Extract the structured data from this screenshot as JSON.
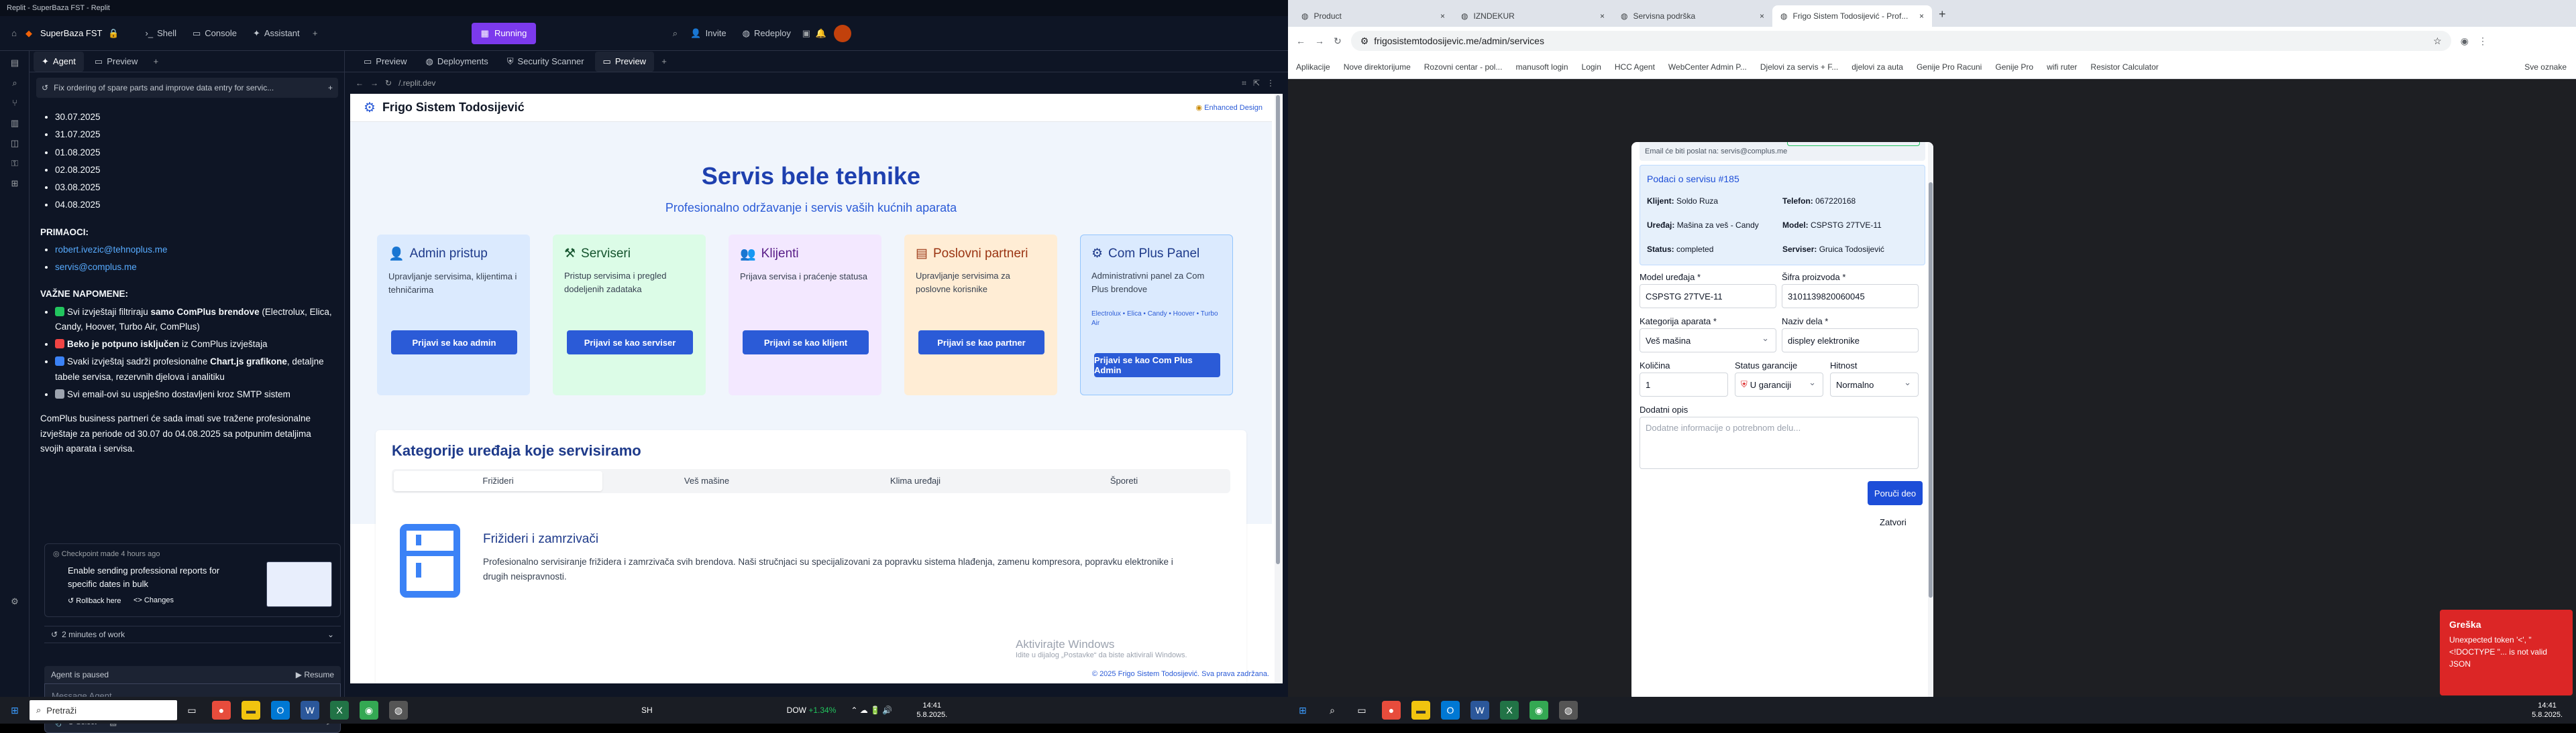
{
  "left_window": {
    "title": "Replit - SuperBaza FST - Replit",
    "project_name": "SuperBaza FST",
    "top_tabs": [
      "Shell",
      "Console",
      "Assistant"
    ],
    "run_status": "Running",
    "invite_label": "Invite",
    "redeploy_label": "Redeploy",
    "agent_tabs": [
      "Agent",
      "Preview"
    ],
    "task_title": "Fix ordering of spare parts and improve data entry for servic...",
    "chat": {
      "dates": [
        "30.07.2025",
        "31.07.2025",
        "01.08.2025",
        "02.08.2025",
        "03.08.2025",
        "04.08.2025"
      ],
      "recipients_title": "PRIMAOCI:",
      "recipients": [
        "robert.ivezic@tehnoplus.me",
        "servis@complus.me"
      ],
      "notes_title": "VAŽNE NAPOMENE:",
      "notes": [
        {
          "icon_color": "#22c55e",
          "pre": "Svi izvještaji filtriraju ",
          "bold": "samo ComPlus brendove",
          "post": " (Electrolux, Elica, Candy, Hoover, Turbo Air, ComPlus)"
        },
        {
          "icon_color": "#ef4444",
          "pre": "",
          "bold": "Beko je potpuno isključen",
          "post": " iz ComPlus izvještaja"
        },
        {
          "icon_color": "#3b82f6",
          "pre": "Svaki izvještaj sadrži profesionalne ",
          "bold": "Chart.js grafikone",
          "post": ", detaljne tabele servisa, rezervnih djelova i analitiku"
        },
        {
          "icon_color": "#9ca3af",
          "pre": "Svi email-ovi su uspješno dostavljeni kroz SMTP sistem",
          "bold": "",
          "post": ""
        }
      ],
      "summary": "ComPlus business partneri će sada imati sve tražene profesionalne izvještaje za periode od 30.07 do 04.08.2025 sa potpunim detaljima svojih aparata i servisa.",
      "checkpoint_label": "Checkpoint made 4 hours ago",
      "checkpoint_title": "Enable sending professional reports for specific dates in bulk",
      "rollback_label": "Rollback here",
      "changes_label": "Changes",
      "work_label": "2 minutes of work",
      "paused_label": "Agent is paused",
      "resume_label": "Resume",
      "message_placeholder": "Message Agent...",
      "select_label": "Select"
    },
    "preview_tabs": [
      "Preview",
      "Deployments",
      "Security Scanner",
      "Preview"
    ],
    "preview_url": "/.replit.dev"
  },
  "site": {
    "brand": "Frigo Sistem Todosijević",
    "enhanced_label": "Enhanced Design",
    "hero_title": "Servis bele tehnike",
    "hero_subtitle": "Profesionalno održavanje i servis vaših kućnih aparata",
    "cards": [
      {
        "title": "Admin pristup",
        "desc": "Upravljanje servisima, klijentima i tehničarima",
        "button": "Prijavi se kao admin",
        "bg": "#dbeafe",
        "color": "#1e3a8a"
      },
      {
        "title": "Serviseri",
        "desc": "Pristup servisima i pregled dodeljenih zadataka",
        "button": "Prijavi se kao serviser",
        "bg": "#dcfce7",
        "color": "#14532d"
      },
      {
        "title": "Klijenti",
        "desc": "Prijava servisa i praćenje statusa",
        "button": "Prijavi se kao klijent",
        "bg": "#f3e8ff",
        "color": "#581c87"
      },
      {
        "title": "Poslovni partneri",
        "desc": "Upravljanje servisima za poslovne korisnike",
        "button": "Prijavi se kao partner",
        "bg": "#ffedd5",
        "color": "#9a3412"
      },
      {
        "title": "Com Plus Panel",
        "desc": "Administrativni panel za Com Plus brendove",
        "extra": "Electrolux • Elica • Candy • Hoover • Turbo Air",
        "button": "Prijavi se kao Com Plus Admin",
        "bg": "#dbeafe",
        "color": "#1e3a8a"
      }
    ],
    "categories_title": "Kategorije uređaja koje servisiramo",
    "category_tabs": [
      "Frižideri",
      "Veš mašine",
      "Klima uređaji",
      "Šporeti"
    ],
    "category_heading": "Frižideri i zamrzivači",
    "category_text": "Profesionalno servisiranje frižidera i zamrzivača svih brendova. Naši stručnjaci su specijalizovani za popravku sistema hlađenja, zamenu kompresora, popravku elektronike i drugih neispravnosti.",
    "footer": "© 2025 Frigo Sistem Todosijević. Sva prava zadržana.",
    "watermark_title": "Aktivirajte Windows",
    "watermark_sub": "Idite u dijalog „Postavke“ da biste aktivirali Windows."
  },
  "right_window": {
    "tabs": [
      "Product",
      "IZNDEKUR",
      "Servisna podrška",
      "Frigo Sistem Todosijević - Prof..."
    ],
    "url": "frigosistemtodosijevic.me/admin/services",
    "bookmarks": [
      "Aplikacije",
      "Nove direktorijume",
      "Rozovni centar - pol...",
      "manusoft login",
      "Login",
      "HCC Agent",
      "WebCenter Admin P...",
      "Djelovi za servis + F...",
      "djelovi za auta",
      "Genije Pro Racuni",
      "Genije Pro",
      "wifi ruter",
      "Resistor Calculator"
    ],
    "other_bookmarks": "Sve oznake",
    "modal": {
      "email_note": "Email će biti poslat na: servis@complus.me",
      "service_title": "Podaci o servisu #185",
      "client": "Soldo Ruza",
      "phone": "067220168",
      "device": "Mašina za veš - Candy",
      "model": "CSPSTG 27TVE-11",
      "status": "completed",
      "technician": "Gruica Todosijević",
      "labels": {
        "client": "Klijent:",
        "phone": "Telefon:",
        "device": "Uređaj:",
        "model": "Model:",
        "status": "Status:",
        "technician": "Serviser:",
        "device_model": "Model uređaja *",
        "product_code": "Šifra proizvoda *",
        "category": "Kategorija aparata *",
        "part_name": "Naziv dela *",
        "quantity": "Količina",
        "warranty": "Status garancije",
        "urgency": "Hitnost",
        "description": "Dodatni opis"
      },
      "device_model_value": "CSPSTG 27TVE-11",
      "product_code_value": "3101139820060045",
      "category_value": "Veš mašina",
      "part_name_value": "displey elektronike",
      "quantity_value": "1",
      "warranty_value": "U garanciji",
      "urgency_value": "Normalno",
      "description_placeholder": "Dodatne informacije o potrebnom delu...",
      "order_button": "Poruči deo",
      "close_button": "Zatvori"
    },
    "toast_title": "Greška",
    "toast_text": "Unexpected token '<', \"<!DOCTYPE \"... is not valid JSON"
  },
  "taskbar_left": {
    "search_placeholder": "Pretraži",
    "weather": "SH",
    "stock_label": "DOW",
    "stock_change": "+1.34%",
    "time": "14:41",
    "date": "5.8.2025."
  },
  "taskbar_right": {
    "time": "14:41",
    "date": "5.8.2025."
  },
  "colors": {
    "replit_bg": "#0e1525",
    "primary": "#2b5bd7",
    "running": "#7c3aed",
    "error": "#dc2626"
  }
}
